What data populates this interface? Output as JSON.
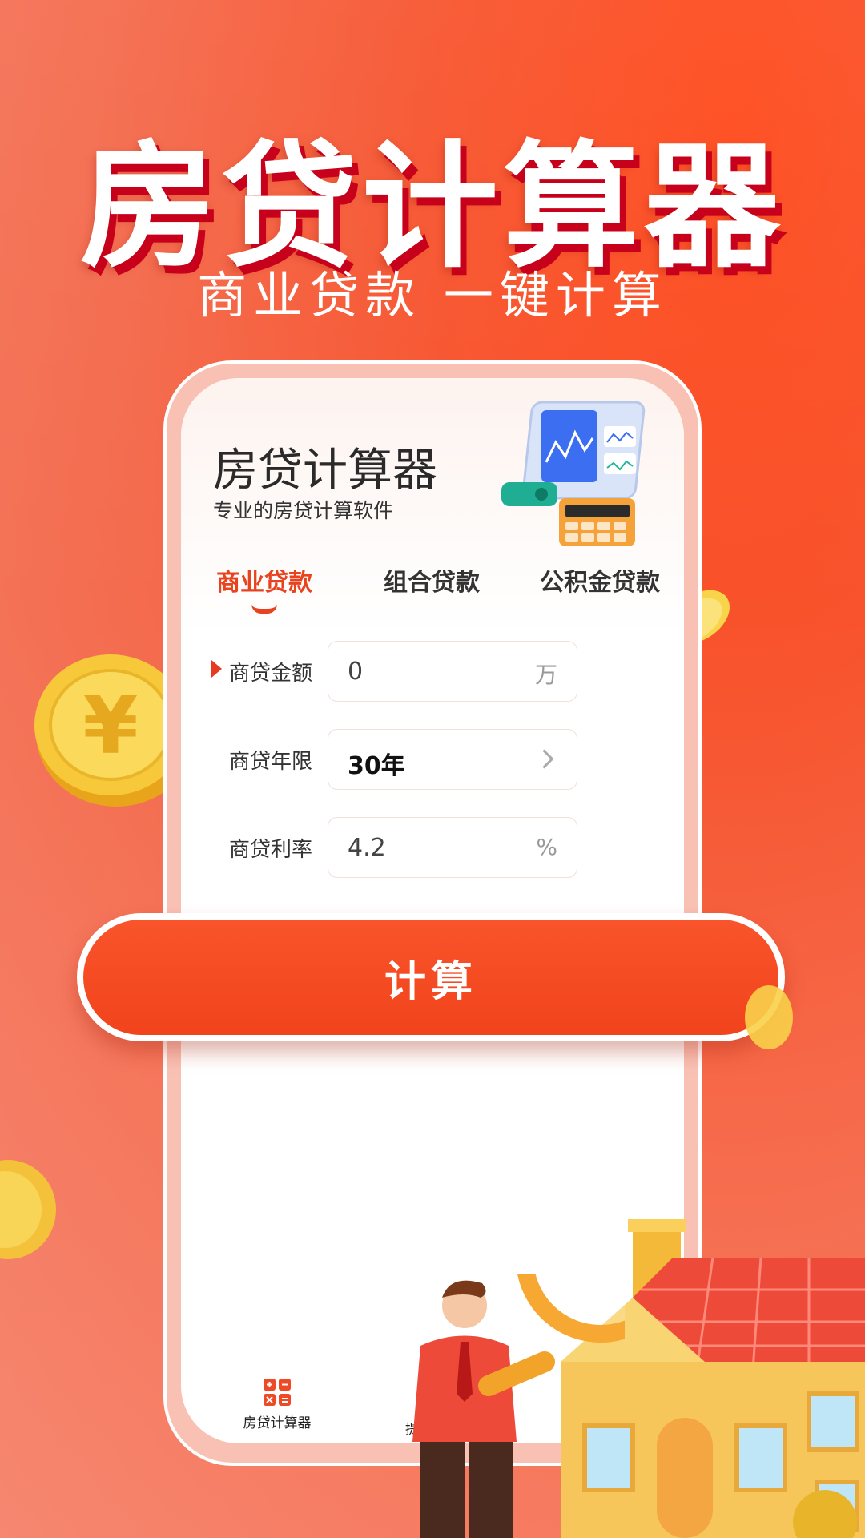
{
  "hero": {
    "title": "房贷计算器",
    "subtitle": "商业贷款  一键计算"
  },
  "app": {
    "title": "房贷计算器",
    "subtitle": "专业的房贷计算软件",
    "tabs": [
      {
        "label": "商业贷款",
        "active": true
      },
      {
        "label": "组合贷款",
        "active": false
      },
      {
        "label": "公积金贷款",
        "active": false
      }
    ],
    "form": {
      "amount": {
        "label": "商贷金额",
        "value": "0",
        "unit": "万"
      },
      "term": {
        "label": "商贷年限",
        "value": "30年"
      },
      "rate": {
        "label": "商贷利率",
        "value": "4.2",
        "unit": "%"
      }
    },
    "calculate_label": "计算",
    "bottom_nav": [
      {
        "label": "房贷计算器",
        "icon": "calculator-icon"
      },
      {
        "label": "提"
      }
    ]
  },
  "colors": {
    "accent": "#e9421f",
    "button": "#f1431c",
    "background": "#f46a4c"
  }
}
